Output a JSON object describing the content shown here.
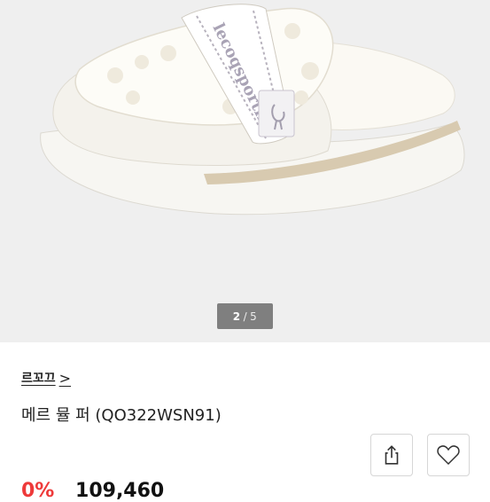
{
  "gallery": {
    "current_page": "2",
    "separator": "/",
    "total_pages": "5",
    "strap_text": "lecoqsportif"
  },
  "product": {
    "brand_label": "르꼬끄",
    "brand_chevron": ">",
    "name": "메르 뮬 퍼 (QO322WSN91)",
    "discount": "0%",
    "price": "109,460"
  },
  "actions": {
    "share_icon": "share-icon",
    "wishlist_icon": "heart-outline-icon"
  },
  "colors": {
    "gallery_background": "#efefef",
    "discount_red": "#ee3a3a",
    "pager_background": "#7f7f7f"
  }
}
